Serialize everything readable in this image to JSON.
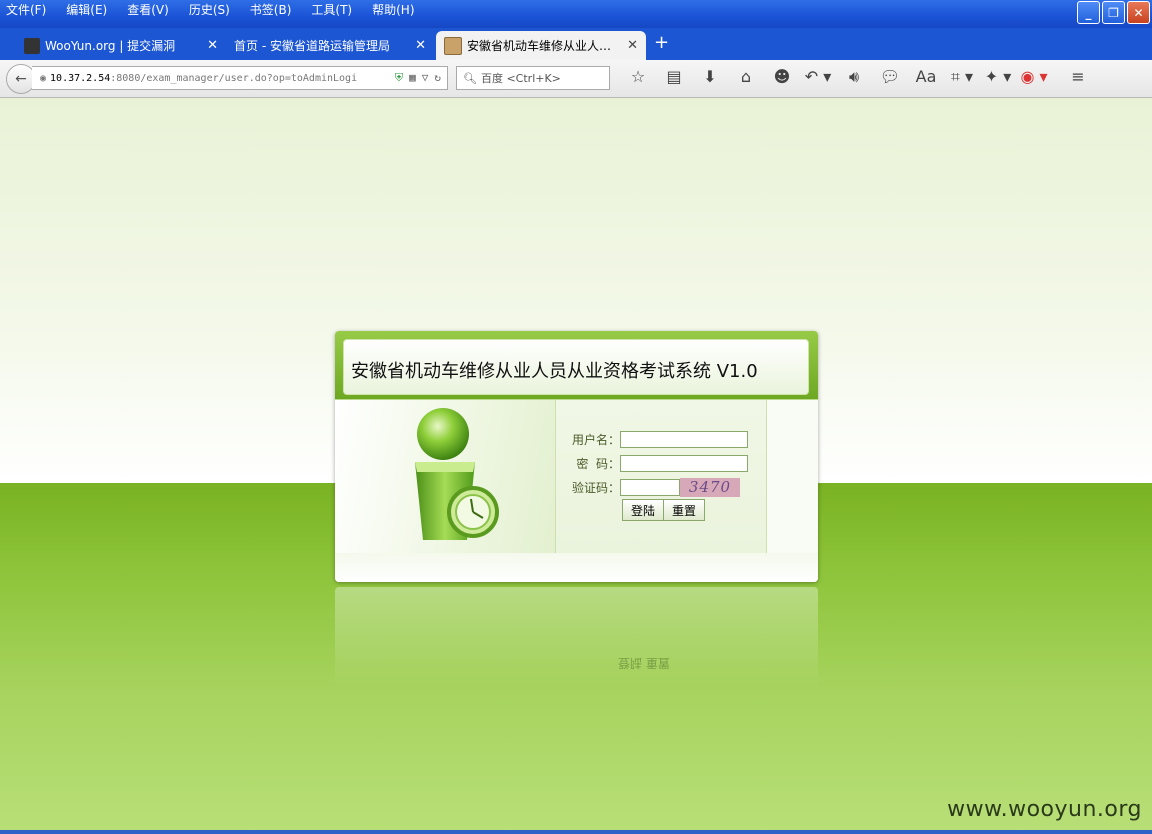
{
  "menu": [
    "文件(F)",
    "编辑(E)",
    "查看(V)",
    "历史(S)",
    "书签(B)",
    "工具(T)",
    "帮助(H)"
  ],
  "window_buttons": {
    "minimize": "_",
    "maximize": "❐",
    "close": "✕"
  },
  "tabs": [
    {
      "label": "WooYun.org | 提交漏洞",
      "active": false
    },
    {
      "label": "首页 - 安徽省道路运输管理局",
      "active": false
    },
    {
      "label": "安徽省机动车维修从业人…",
      "active": true
    }
  ],
  "new_tab": "+",
  "address": {
    "host": "10.37.2.54",
    "rest": ":8080/exam_manager/user.do?op=toAdminLogi"
  },
  "search": {
    "placeholder": "百度 <Ctrl+K>"
  },
  "login": {
    "title": "安徽省机动车维修从业人员从业资格考试系统 V1.0",
    "username_label": "用户名：",
    "password_label": "密  码：",
    "captcha_label": "验证码：",
    "captcha_text": "3470",
    "login_button": "登陆",
    "reset_button": "重置"
  },
  "reflection_text": "登陆 重置",
  "watermark": "www.wooyun.org",
  "colors": {
    "accent_green": "#79b222",
    "titlebar_blue": "#1c56d3"
  }
}
